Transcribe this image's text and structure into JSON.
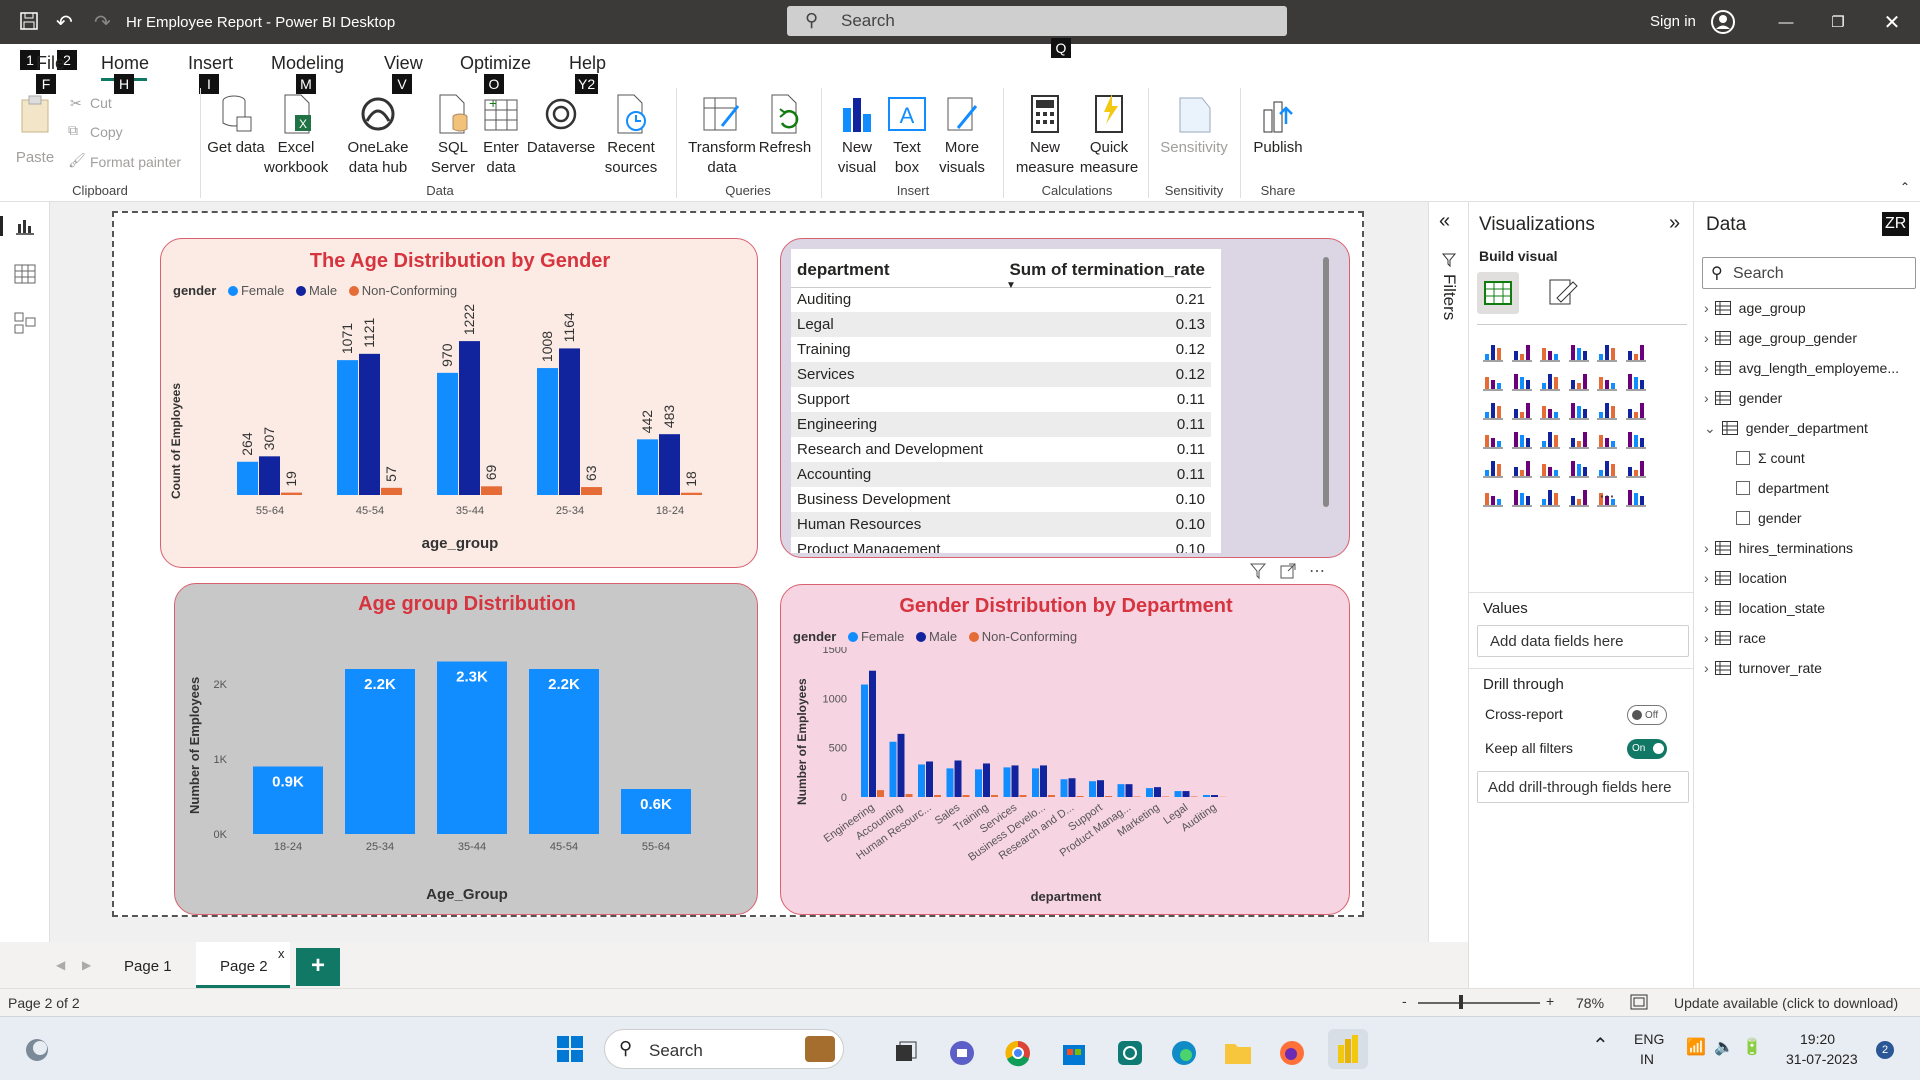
{
  "titlebar": {
    "title": "Hr Employee Report - Power BI Desktop",
    "search_placeholder": "Search",
    "search_key": "Q",
    "sign_in": "Sign in"
  },
  "ribbon": {
    "tabs": [
      {
        "label": "File",
        "keytip": "F"
      },
      {
        "label": "Home",
        "keytip": "H"
      },
      {
        "label": "Insert",
        "keytip": "I"
      },
      {
        "label": "Modeling",
        "keytip": "M"
      },
      {
        "label": "View",
        "keytip": "V"
      },
      {
        "label": "Optimize",
        "keytip": "O"
      },
      {
        "label": "Help",
        "keytip": "Y2"
      }
    ],
    "qat_keytips": [
      "1",
      "2"
    ],
    "clipboard": {
      "paste": "Paste",
      "cut": "Cut",
      "copy": "Copy",
      "format_painter": "Format painter",
      "group": "Clipboard"
    },
    "data": {
      "get_data": "Get data",
      "excel": "Excel workbook",
      "onelake": "OneLake data hub",
      "sql": "SQL Server",
      "enter": "Enter data",
      "dataverse": "Dataverse",
      "recent": "Recent sources",
      "group": "Data"
    },
    "queries": {
      "transform": "Transform data",
      "refresh": "Refresh",
      "group": "Queries"
    },
    "insert": {
      "new_visual": "New visual",
      "text_box": "Text box",
      "more_visuals": "More visuals",
      "group": "Insert"
    },
    "calculations": {
      "new_measure": "New measure",
      "quick_measure": "Quick measure",
      "group": "Calculations"
    },
    "sensitivity": {
      "label": "Sensitivity",
      "group": "Sensitivity"
    },
    "share": {
      "publish": "Publish",
      "group": "Share"
    }
  },
  "colors": {
    "female": "#118dff",
    "male": "#12239e",
    "nonconf": "#e66c37",
    "accent_red": "#d6343f"
  },
  "charts": {
    "age_gender": {
      "title": "The Age Distribution by Gender",
      "legend_title": "gender",
      "series_names": [
        "Female",
        "Male",
        "Non-Conforming"
      ],
      "ylabel": "Count of Employees",
      "xlabel": "age_group"
    },
    "age_group": {
      "title": "Age group Distribution",
      "ylabel": "Number of Employees",
      "xlabel": "Age_Group"
    },
    "gender_dept": {
      "title": "Gender Distribution by Department",
      "legend_title": "gender",
      "series_names": [
        "Female",
        "Male",
        "Non-Conforming"
      ],
      "ylabel": "Number of Employees",
      "xlabel": "department"
    }
  },
  "chart_data": [
    {
      "type": "bar",
      "title": "The Age Distribution by Gender",
      "categories": [
        "55-64",
        "45-54",
        "35-44",
        "25-34",
        "18-24"
      ],
      "series": [
        {
          "name": "Female",
          "values": [
            264,
            1071,
            970,
            1008,
            442
          ]
        },
        {
          "name": "Male",
          "values": [
            307,
            1121,
            1222,
            1164,
            483
          ]
        },
        {
          "name": "Non-Conforming",
          "values": [
            19,
            57,
            69,
            63,
            18
          ]
        }
      ],
      "xlabel": "age_group",
      "ylabel": "Count of Employees",
      "ylim": [
        0,
        1350
      ],
      "legend": "top-left"
    },
    {
      "type": "table",
      "columns": [
        "department",
        "Sum of termination_rate"
      ],
      "rows": [
        [
          "Auditing",
          "0.21"
        ],
        [
          "Legal",
          "0.13"
        ],
        [
          "Training",
          "0.12"
        ],
        [
          "Services",
          "0.12"
        ],
        [
          "Support",
          "0.11"
        ],
        [
          "Engineering",
          "0.11"
        ],
        [
          "Research and Development",
          "0.11"
        ],
        [
          "Accounting",
          "0.11"
        ],
        [
          "Business Development",
          "0.10"
        ],
        [
          "Human Resources",
          "0.10"
        ],
        [
          "Product Management",
          "0.10"
        ]
      ]
    },
    {
      "type": "bar",
      "title": "Age group Distribution",
      "categories": [
        "18-24",
        "25-34",
        "35-44",
        "45-54",
        "55-64"
      ],
      "values": [
        900,
        2200,
        2300,
        2200,
        600
      ],
      "data_labels": [
        "0.9K",
        "2.2K",
        "2.3K",
        "2.2K",
        "0.6K"
      ],
      "y_ticks": [
        "0K",
        "1K",
        "2K"
      ],
      "xlabel": "Age_Group",
      "ylabel": "Number of Employees",
      "ylim": [
        0,
        2400
      ]
    },
    {
      "type": "bar",
      "title": "Gender Distribution by Department",
      "categories": [
        "Engineering",
        "Accounting",
        "Human Resourc...",
        "Sales",
        "Training",
        "Services",
        "Business Develo...",
        "Research and D...",
        "Support",
        "Product Manag...",
        "Marketing",
        "Legal",
        "Auditing"
      ],
      "series": [
        {
          "name": "Female",
          "values": [
            1140,
            560,
            330,
            290,
            280,
            300,
            290,
            180,
            160,
            130,
            90,
            60,
            20
          ]
        },
        {
          "name": "Male",
          "values": [
            1280,
            640,
            360,
            370,
            340,
            320,
            320,
            190,
            170,
            130,
            100,
            60,
            20
          ]
        },
        {
          "name": "Non-Conforming",
          "values": [
            70,
            30,
            20,
            20,
            20,
            20,
            20,
            10,
            10,
            5,
            5,
            5,
            2
          ]
        }
      ],
      "y_ticks": [
        "0",
        "500",
        "1000",
        "1500"
      ],
      "xlabel": "department",
      "ylabel": "Number of Employees",
      "ylim": [
        0,
        1500
      ],
      "legend": "top-left"
    }
  ],
  "viz_pane": {
    "title": "Visualizations",
    "build_visual": "Build visual",
    "values": "Values",
    "add_data_fields": "Add data fields here",
    "drill_through": "Drill through",
    "cross_report": "Cross-report",
    "cross_report_state": "Off",
    "keep_all_filters": "Keep all filters",
    "keep_all_filters_state": "On",
    "add_drill_fields": "Add drill-through fields here"
  },
  "filters_pane": {
    "label": "Filters"
  },
  "data_pane": {
    "title": "Data",
    "keytip": "ZR",
    "search_placeholder": "Search",
    "tables": [
      "age_group",
      "age_group_gender",
      "avg_length_employeme...",
      "gender",
      "gender_department",
      "hires_terminations",
      "location",
      "location_state",
      "race",
      "turnover_rate"
    ],
    "expanded_fields": [
      "count",
      "department",
      "gender"
    ]
  },
  "pages": {
    "tabs": [
      "Page 1",
      "Page 2"
    ],
    "active": "Page 2",
    "add": "+"
  },
  "status": {
    "page": "Page 2 of 2",
    "zoom": "78%",
    "update": "Update available (click to download)"
  },
  "taskbar": {
    "search": "Search",
    "lang1": "ENG",
    "lang2": "IN",
    "time": "19:20",
    "date": "31-07-2023",
    "badge": "2"
  }
}
